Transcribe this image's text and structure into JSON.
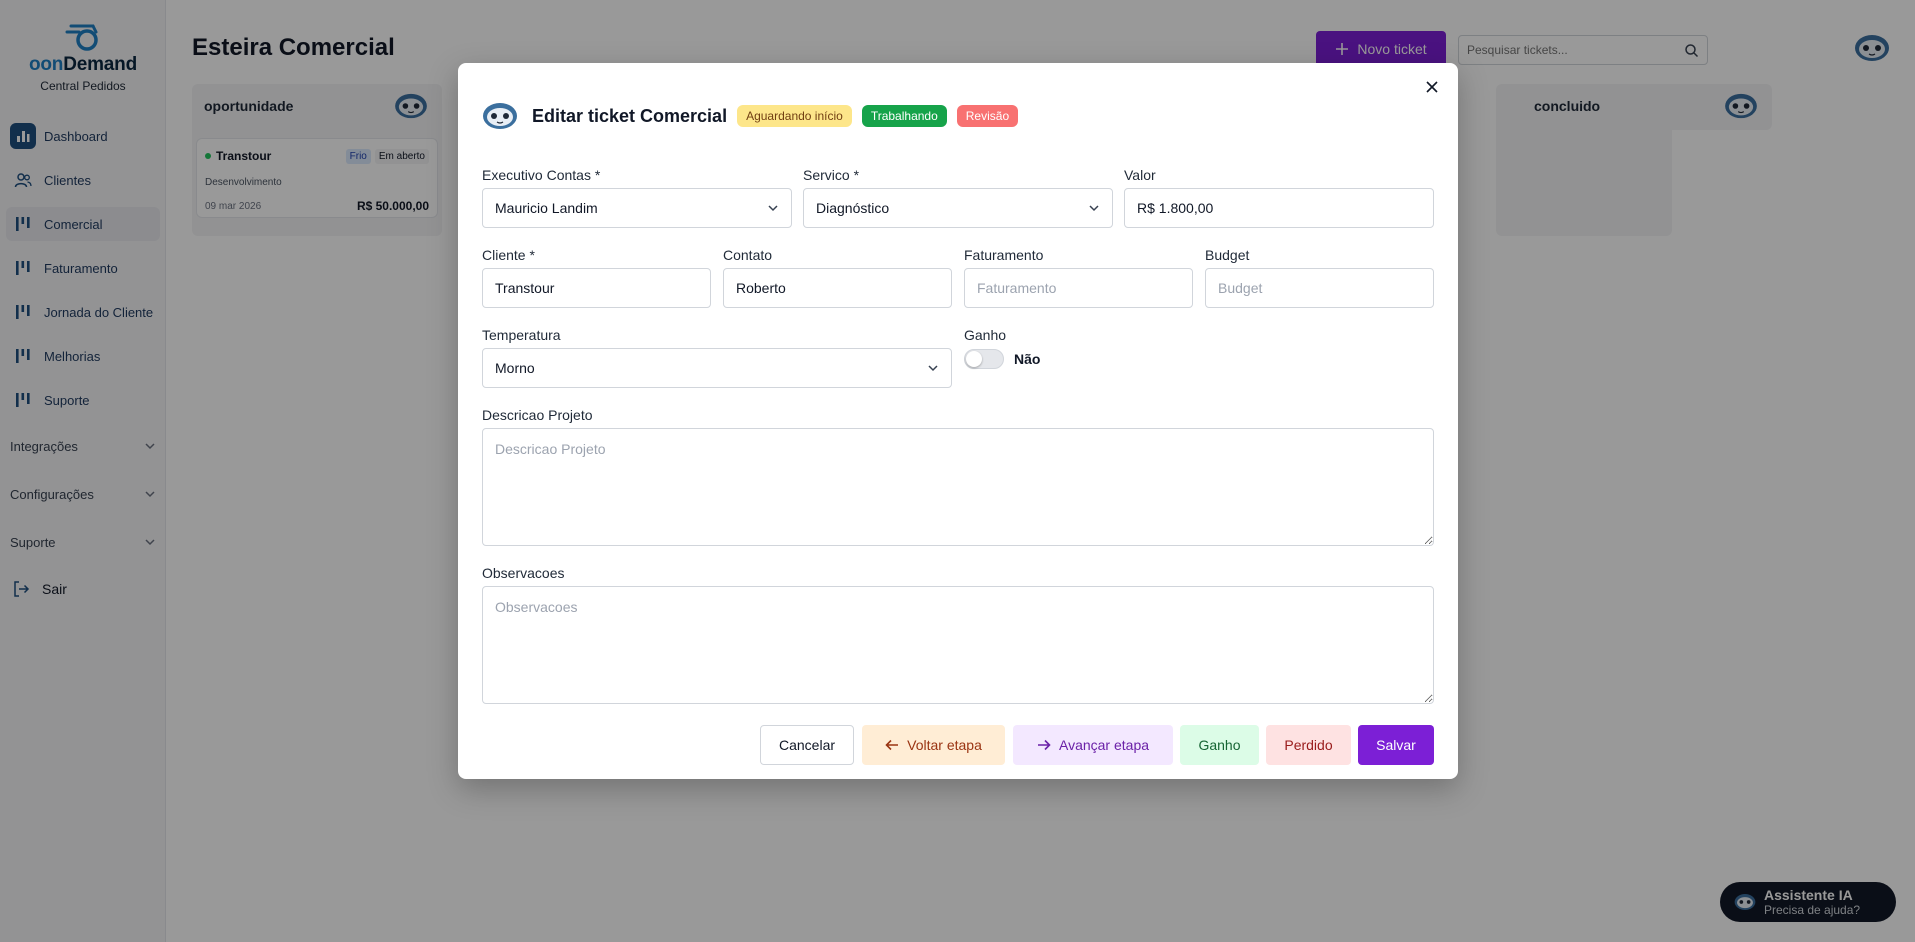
{
  "sidebar": {
    "logo_prefix": "oon",
    "logo_suffix": "Demand",
    "subtitle": "Central Pedidos",
    "items": [
      {
        "label": "Dashboard"
      },
      {
        "label": "Clientes"
      },
      {
        "label": "Comercial"
      },
      {
        "label": "Faturamento"
      },
      {
        "label": "Jornada do Cliente"
      },
      {
        "label": "Melhorias"
      },
      {
        "label": "Suporte"
      }
    ],
    "groups": [
      {
        "label": "Integrações"
      },
      {
        "label": "Configurações"
      },
      {
        "label": "Suporte"
      }
    ],
    "exit_label": "Sair"
  },
  "header": {
    "title": "Esteira Comercial",
    "new_ticket_label": "Novo ticket",
    "search_placeholder": "Pesquisar tickets..."
  },
  "board": {
    "columns": [
      {
        "name": "oportunidade"
      },
      {
        "name": "concluido"
      }
    ],
    "ticket": {
      "client": "Transtour",
      "badge_temp": "Frio",
      "badge_status": "Em aberto",
      "stage": "Desenvolvimento",
      "date": "09 mar 2026",
      "value": "R$ 50.000,00"
    }
  },
  "modal": {
    "title": "Editar ticket Comercial",
    "pills": [
      {
        "label": "Aguardando início"
      },
      {
        "label": "Trabalhando"
      },
      {
        "label": "Revisão"
      }
    ],
    "fields": {
      "executivo": {
        "label": "Executivo Contas *",
        "value": "Mauricio Landim"
      },
      "servico": {
        "label": "Servico *",
        "value": "Diagnóstico"
      },
      "valor": {
        "label": "Valor",
        "value": "R$ 1.800,00"
      },
      "cliente": {
        "label": "Cliente *",
        "value": "Transtour"
      },
      "contato": {
        "label": "Contato",
        "value": "Roberto"
      },
      "faturamento": {
        "label": "Faturamento",
        "placeholder": "Faturamento"
      },
      "budget": {
        "label": "Budget",
        "placeholder": "Budget"
      },
      "temperatura": {
        "label": "Temperatura",
        "value": "Morno"
      },
      "ganho": {
        "label": "Ganho",
        "value_text": "Não"
      },
      "descricao": {
        "label": "Descricao Projeto",
        "placeholder": "Descricao Projeto"
      },
      "observacoes": {
        "label": "Observacoes",
        "placeholder": "Observacoes"
      }
    },
    "buttons": {
      "cancel": "Cancelar",
      "back": "Voltar etapa",
      "next": "Avançar etapa",
      "won": "Ganho",
      "lost": "Perdido",
      "save": "Salvar"
    }
  },
  "assistant": {
    "title": "Assistente IA",
    "subtitle": "Precisa de ajuda?"
  },
  "colors": {
    "primary": "#7c1fd6",
    "brand_blue": "#1f7fc4",
    "pill_waiting_bg": "#fde68a",
    "pill_working_bg": "#16a34a",
    "pill_review_bg": "#f87171"
  }
}
